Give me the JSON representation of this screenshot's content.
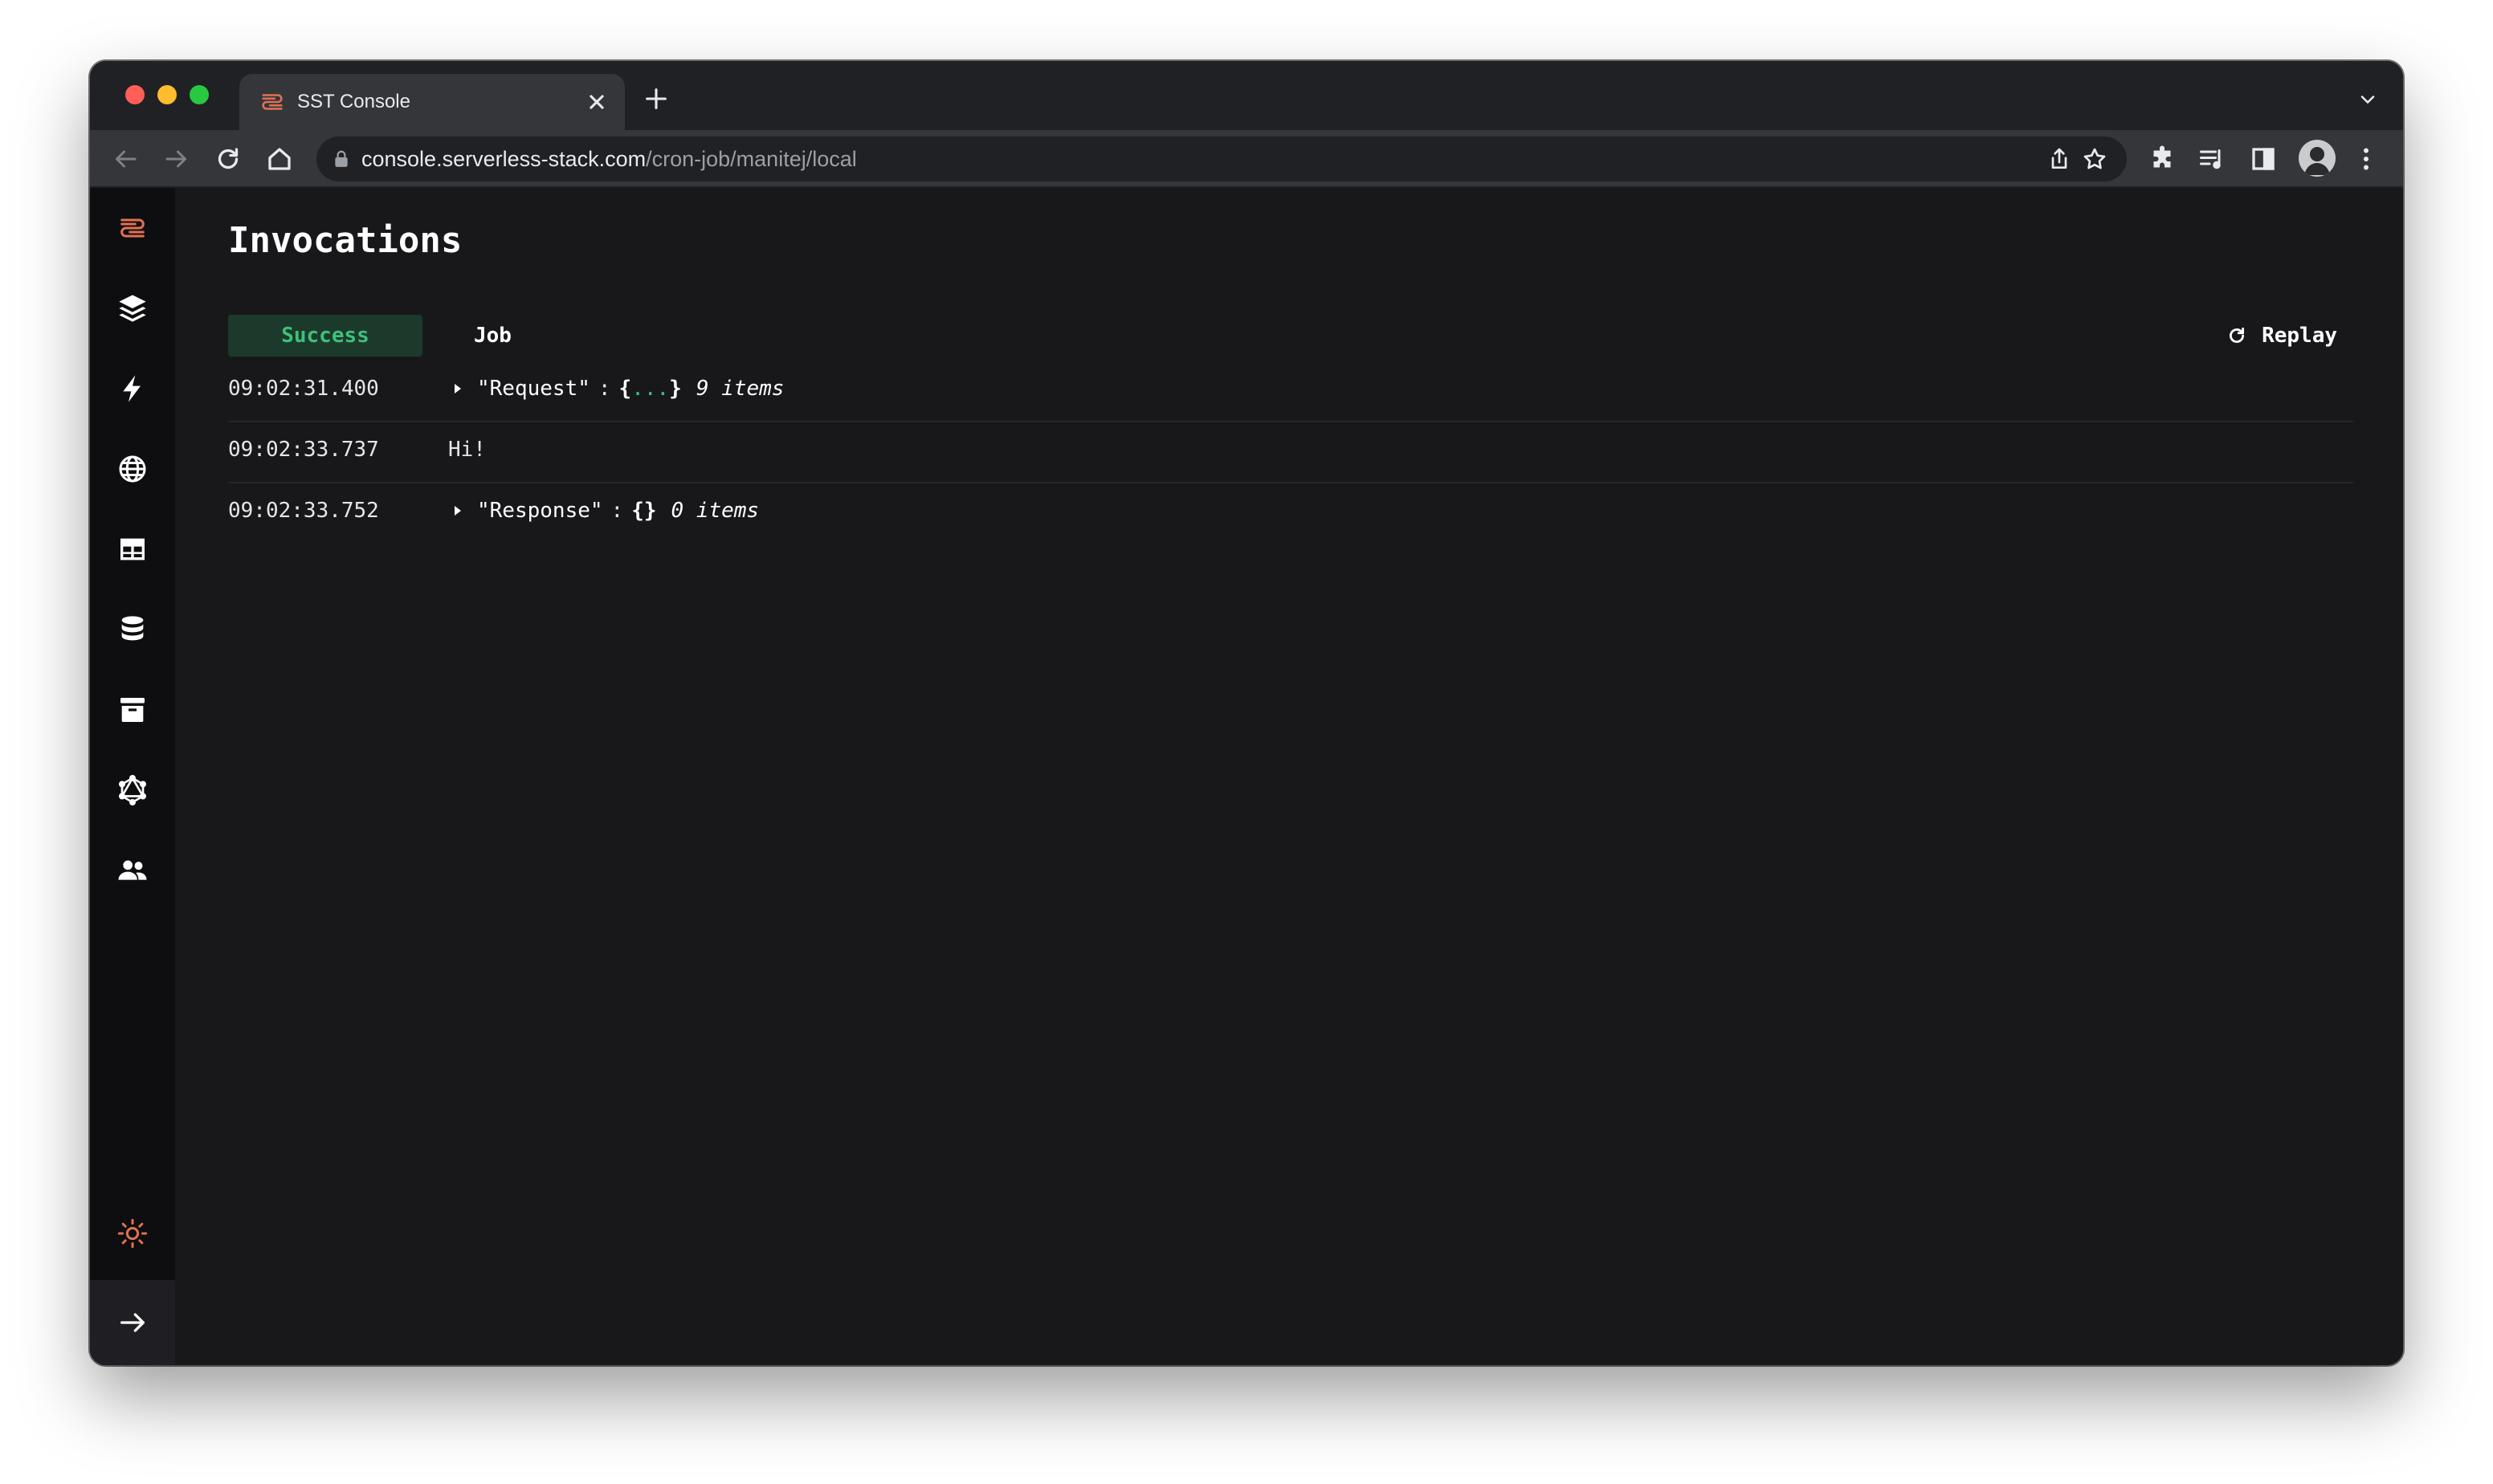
{
  "browser": {
    "tab_title": "SST Console",
    "url_host": "console.serverless-stack.com",
    "url_path": "/cron-job/manitej/local"
  },
  "page": {
    "title": "Invocations",
    "status_badge": "Success",
    "function_name": "Job",
    "replay_label": "Replay"
  },
  "log": [
    {
      "time": "09:02:31.400",
      "key": "\"Request\"",
      "colon": ":",
      "open": "{",
      "ellipsis": "...",
      "close": "}",
      "count": "9 items"
    },
    {
      "time": "09:02:33.737",
      "text": "Hi!"
    },
    {
      "time": "09:02:33.752",
      "key": "\"Response\"",
      "colon": ":",
      "braces": "{}",
      "count": "0 items"
    }
  ],
  "sidebar": {
    "items": [
      "sst-logo-icon",
      "stacks-icon",
      "functions-icon",
      "api-icon",
      "dynamodb-icon",
      "rds-icon",
      "buckets-icon",
      "graphql-icon",
      "cognito-icon"
    ],
    "footer": [
      "theme-sun-icon",
      "expand-arrow-icon"
    ]
  },
  "colors": {
    "accent_orange": "#e27152",
    "success_green": "#3ec07a",
    "success_bg": "#1c3a2b",
    "background": "#18181b",
    "sidebar_bg": "#0e0e10"
  }
}
